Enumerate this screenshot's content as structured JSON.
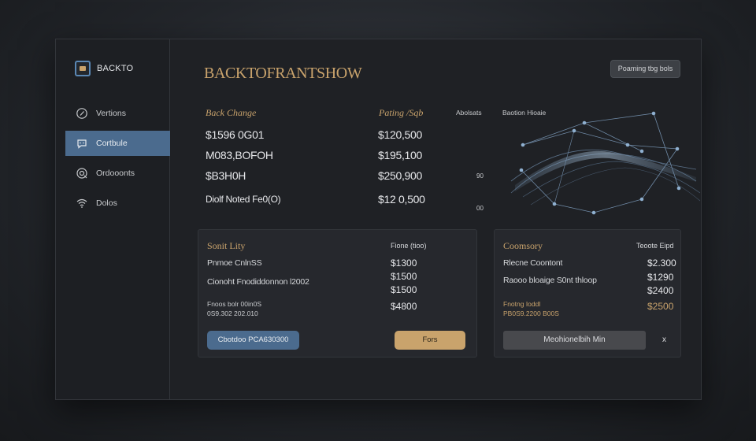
{
  "sidebar": {
    "logo_text": "BACKTO",
    "items": [
      {
        "label": "Vertions",
        "icon": "tag-icon",
        "active": false
      },
      {
        "label": "Cortbule",
        "icon": "chat-icon",
        "active": true
      },
      {
        "label": "Ordooonts",
        "icon": "target-icon",
        "active": false
      },
      {
        "label": "Dolos",
        "icon": "wifi-icon",
        "active": false
      }
    ]
  },
  "header": {
    "brand": "BACKTOFRANTSHOW",
    "top_button": "Poaming tbg bols"
  },
  "table": {
    "col1_header": "Back Change",
    "col2_header": "Pating /Sqb",
    "col3_label": "Abolsats",
    "rows": [
      {
        "label": "$1596 0G01",
        "value": "$120,500"
      },
      {
        "label": "M083,BOFOH",
        "value": "$195,100"
      },
      {
        "label": "$B3H0H",
        "value": "$250,900"
      },
      {
        "label": "Diolf Noted Fe0(O)",
        "value": "$12 0,500"
      }
    ],
    "axis": [
      "90",
      "00"
    ]
  },
  "chart": {
    "title": "Baotion Hioaie",
    "accent": "#7d9dbd"
  },
  "card_left": {
    "title": "Sonit Lity",
    "head": "Fione (tioo)",
    "rows": [
      {
        "label": "Pnmoe CnlnSS",
        "value": "$1300"
      },
      {
        "label": "Cionoht Fnodiddonnon l2002",
        "value": "$1500"
      },
      {
        "label": "",
        "value": "$1500"
      }
    ],
    "note_line1": "Fnoos bolr 00in0S",
    "note_line2": "0S9.302 202.010",
    "note_value": "$4800",
    "btn_primary": "Cbotdoo PCA630300",
    "btn_secondary": "Fors"
  },
  "card_right": {
    "title": "Coomsory",
    "head": "Teoote Eipd",
    "rows": [
      {
        "label": "Rlecne Coontont",
        "value": "$2.300"
      },
      {
        "label": "Raooo bloaige S0nt thloop",
        "value": "$1290"
      },
      {
        "label": "",
        "value": "$2400"
      }
    ],
    "note_line1": "Fnotng Ioddl",
    "note_line2": "PB0S9.2200 B00S",
    "note_value": "$2500",
    "btn": "Meohionelbih Min",
    "close": "x"
  }
}
